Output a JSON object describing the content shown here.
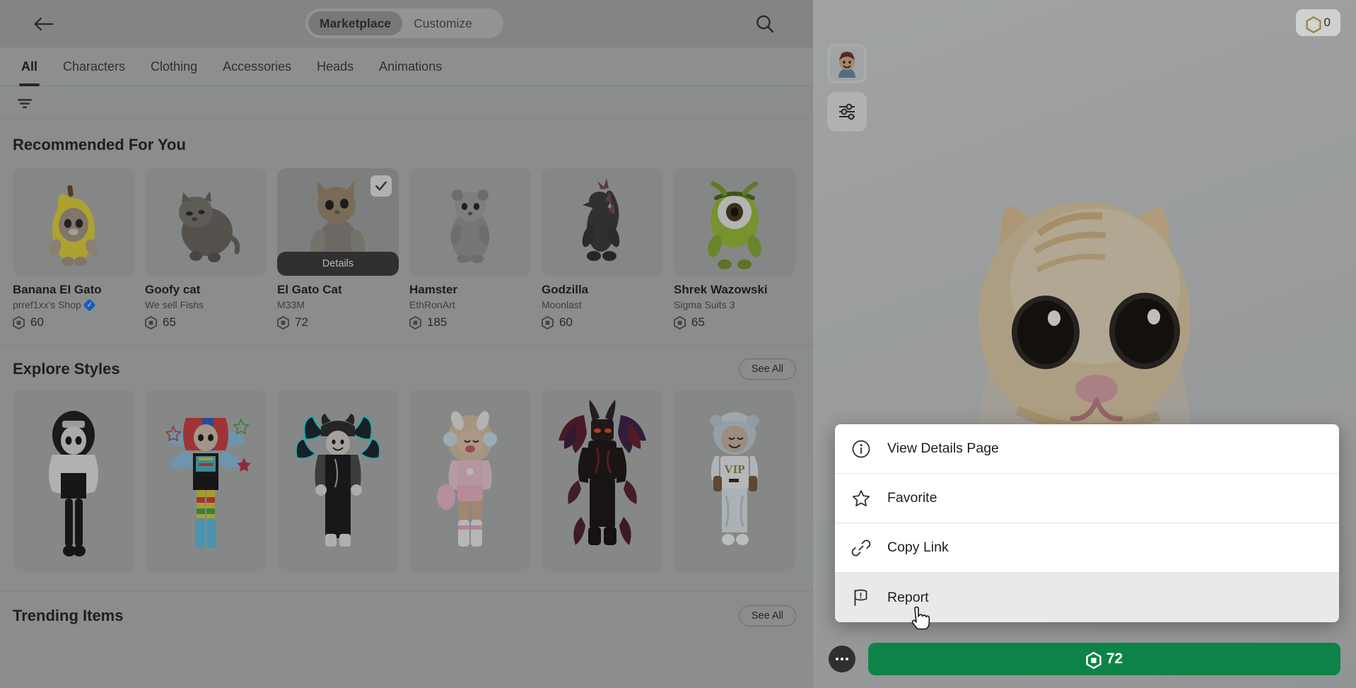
{
  "header": {
    "back_icon": "arrow-left-icon",
    "search_icon": "search-icon",
    "tabs": [
      {
        "label": "Marketplace",
        "active": true
      },
      {
        "label": "Customize",
        "active": false
      }
    ],
    "balance": {
      "value": "0",
      "icon": "robux-icon"
    }
  },
  "categories": [
    {
      "label": "All",
      "active": true
    },
    {
      "label": "Characters",
      "active": false
    },
    {
      "label": "Clothing",
      "active": false
    },
    {
      "label": "Accessories",
      "active": false
    },
    {
      "label": "Heads",
      "active": false
    },
    {
      "label": "Animations",
      "active": false
    }
  ],
  "filter": {
    "icon": "filter-icon"
  },
  "sections": {
    "recommended": {
      "title": "Recommended For You",
      "items": [
        {
          "name": "Banana El Gato",
          "creator": "prref1xx's Shop",
          "verified": true,
          "price": "60",
          "selected": false,
          "art": "banana-cat"
        },
        {
          "name": "Goofy cat",
          "creator": "We sell Fishs",
          "verified": false,
          "price": "65",
          "selected": false,
          "art": "goofy-cat"
        },
        {
          "name": "El Gato Cat",
          "creator": "M33M",
          "verified": false,
          "price": "72",
          "selected": true,
          "art": "el-gato-cat",
          "details_label": "Details"
        },
        {
          "name": "Hamster",
          "creator": "EthRonArt",
          "verified": false,
          "price": "185",
          "selected": false,
          "art": "hamster"
        },
        {
          "name": "Godzilla",
          "creator": "Moonlast",
          "verified": false,
          "price": "60",
          "selected": false,
          "art": "godzilla"
        },
        {
          "name": "Shrek Wazowski",
          "creator": "Sigma Suits 3",
          "verified": false,
          "price": "65",
          "selected": false,
          "art": "shrek-wazowski"
        }
      ]
    },
    "explore_styles": {
      "title": "Explore Styles",
      "see_all_label": "See All",
      "styles": [
        {
          "art": "goth-girl-avatar"
        },
        {
          "art": "rainbow-star-avatar"
        },
        {
          "art": "black-emo-avatar"
        },
        {
          "art": "pink-bunny-avatar"
        },
        {
          "art": "red-demon-avatar"
        },
        {
          "art": "white-vip-avatar"
        }
      ]
    },
    "trending": {
      "title": "Trending Items",
      "see_all_label": "See All"
    }
  },
  "right_tools": [
    {
      "name": "avatar-preview-button",
      "icon": "avatar-icon"
    },
    {
      "name": "settings-button",
      "icon": "sliders-icon"
    }
  ],
  "context_menu": {
    "items": [
      {
        "label": "View Details Page",
        "icon": "info-circle-icon",
        "hovered": false
      },
      {
        "label": "Favorite",
        "icon": "star-icon",
        "hovered": false
      },
      {
        "label": "Copy Link",
        "icon": "link-icon",
        "hovered": false
      },
      {
        "label": "Report",
        "icon": "flag-icon",
        "hovered": true
      }
    ]
  },
  "bottom_bar": {
    "more_icon": "more-dots-icon",
    "buy_price": "72",
    "buy_icon": "robux-icon",
    "buy_color": "#0e8348"
  },
  "colors": {
    "accent_green": "#0e8348",
    "verified_blue": "#1a7af8",
    "panel_bg": "#b9bbbb",
    "menu_bg": "#ffffff",
    "menu_hover": "#e9e9e9"
  }
}
